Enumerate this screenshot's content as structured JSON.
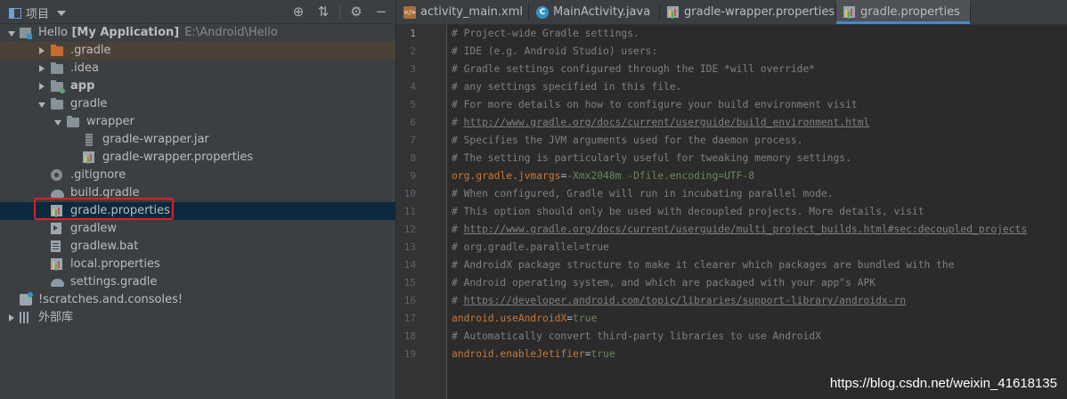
{
  "project_panel": {
    "title": "项目",
    "tree": [
      {
        "label": "Hello",
        "bold": "[My Application]",
        "hint": "E:\\Android\\Hello",
        "icon": "module-root",
        "arrow": "down",
        "indent": 0
      },
      {
        "label": ".gradle",
        "icon": "folder-orange",
        "arrow": "right",
        "indent": 1
      },
      {
        "label": ".idea",
        "icon": "folder",
        "arrow": "right",
        "indent": 1
      },
      {
        "label": "app",
        "icon": "module-folder",
        "arrow": "right",
        "indent": 1,
        "strong": true
      },
      {
        "label": "gradle",
        "icon": "folder",
        "arrow": "down",
        "indent": 1
      },
      {
        "label": "wrapper",
        "icon": "folder",
        "arrow": "down",
        "indent": 2
      },
      {
        "label": "gradle-wrapper.jar",
        "icon": "jar",
        "indent": 3
      },
      {
        "label": "gradle-wrapper.properties",
        "icon": "properties",
        "indent": 3
      },
      {
        "label": ".gitignore",
        "icon": "gitignore",
        "indent": 1
      },
      {
        "label": "build.gradle",
        "icon": "gradle",
        "indent": 1
      },
      {
        "label": "gradle.properties",
        "icon": "properties",
        "indent": 1,
        "selected": true
      },
      {
        "label": "gradlew",
        "icon": "script",
        "indent": 1
      },
      {
        "label": "gradlew.bat",
        "icon": "batfile",
        "indent": 1
      },
      {
        "label": "local.properties",
        "icon": "properties",
        "indent": 1
      },
      {
        "label": "settings.gradle",
        "icon": "gradle",
        "indent": 1
      },
      {
        "label": "!scratches.and.consoles!",
        "icon": "scratch",
        "indent": 0
      },
      {
        "label": "外部库",
        "icon": "libraries",
        "arrow": "right",
        "indent": 0
      }
    ]
  },
  "tabs": [
    {
      "label": "activity_main.xml",
      "icon": "xml-icon",
      "icon_text": "</>"
    },
    {
      "label": "MainActivity.java",
      "icon": "class-icon",
      "icon_text": "C"
    },
    {
      "label": "gradle-wrapper.properties",
      "icon": "properties-icon"
    },
    {
      "label": "gradle.properties",
      "icon": "properties-icon",
      "active": true
    }
  ],
  "editor": {
    "lines": [
      {
        "n": "1",
        "parts": [
          {
            "t": "# Project-wide Gradle settings.",
            "c": "comment"
          }
        ]
      },
      {
        "n": "2",
        "parts": [
          {
            "t": "# IDE (e.g. Android Studio) users:",
            "c": "comment"
          }
        ]
      },
      {
        "n": "3",
        "parts": [
          {
            "t": "# Gradle settings configured through the IDE *will override*",
            "c": "comment"
          }
        ]
      },
      {
        "n": "4",
        "parts": [
          {
            "t": "# any settings specified in this file.",
            "c": "comment"
          }
        ]
      },
      {
        "n": "5",
        "parts": [
          {
            "t": "# For more details on how to configure your build environment visit",
            "c": "comment"
          }
        ]
      },
      {
        "n": "6",
        "parts": [
          {
            "t": "# ",
            "c": "comment"
          },
          {
            "t": "http://www.gradle.org/docs/current/userguide/build_environment.html",
            "c": "link"
          }
        ]
      },
      {
        "n": "7",
        "parts": [
          {
            "t": "# Specifies the JVM arguments used for the daemon process.",
            "c": "comment"
          }
        ]
      },
      {
        "n": "8",
        "parts": [
          {
            "t": "# The setting is particularly useful for tweaking memory settings.",
            "c": "comment"
          }
        ]
      },
      {
        "n": "9",
        "parts": [
          {
            "t": "org.gradle.jvmargs",
            "c": "key"
          },
          {
            "t": "=",
            "c": "eq"
          },
          {
            "t": "-Xmx2048m -Dfile.encoding=UTF-8",
            "c": "val"
          }
        ]
      },
      {
        "n": "10",
        "parts": [
          {
            "t": "# When configured, Gradle will run in incubating parallel mode.",
            "c": "comment"
          }
        ]
      },
      {
        "n": "11",
        "parts": [
          {
            "t": "# This option should only be used with decoupled projects. More details, visit",
            "c": "comment"
          }
        ]
      },
      {
        "n": "12",
        "parts": [
          {
            "t": "# ",
            "c": "comment"
          },
          {
            "t": "http://www.gradle.org/docs/current/userguide/multi_project_builds.html#sec:decoupled_projects",
            "c": "link"
          }
        ]
      },
      {
        "n": "13",
        "parts": [
          {
            "t": "# org.gradle.parallel=true",
            "c": "comment"
          }
        ]
      },
      {
        "n": "14",
        "parts": [
          {
            "t": "# AndroidX package structure to make it clearer which packages are bundled with the",
            "c": "comment"
          }
        ]
      },
      {
        "n": "15",
        "parts": [
          {
            "t": "# Android operating system, and which are packaged with your app\"s APK",
            "c": "comment"
          }
        ]
      },
      {
        "n": "16",
        "parts": [
          {
            "t": "# ",
            "c": "comment"
          },
          {
            "t": "https://developer.android.com/topic/libraries/support-library/androidx-rn",
            "c": "link"
          }
        ]
      },
      {
        "n": "17",
        "parts": [
          {
            "t": "android.useAndroidX",
            "c": "key"
          },
          {
            "t": "=",
            "c": "eq"
          },
          {
            "t": "true",
            "c": "val"
          }
        ]
      },
      {
        "n": "18",
        "parts": [
          {
            "t": "# Automatically convert third-party libraries to use AndroidX",
            "c": "comment"
          }
        ]
      },
      {
        "n": "19",
        "parts": [
          {
            "t": "android.enableJetifier",
            "c": "key"
          },
          {
            "t": "=",
            "c": "eq"
          },
          {
            "t": "true",
            "c": "val"
          }
        ]
      }
    ]
  },
  "watermark": "https://blog.csdn.net/weixin_41618135",
  "colors": {
    "selection": "#0d293e",
    "highlight_box": "#e02020",
    "accent_tab": "#4a88c7"
  }
}
